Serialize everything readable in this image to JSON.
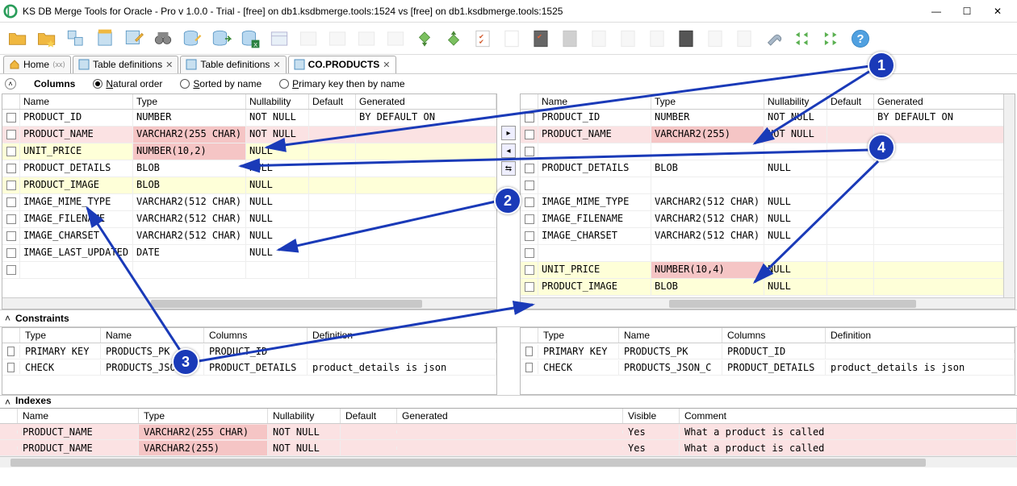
{
  "title": "KS DB Merge Tools for Oracle - Pro v 1.0.0 - Trial - [free] on db1.ksdbmerge.tools:1524 vs [free] on db1.ksdbmerge.tools:1525",
  "tabs": [
    {
      "label": "Home",
      "icon": "home"
    },
    {
      "label": "Table definitions",
      "icon": "grid"
    },
    {
      "label": "Table definitions",
      "icon": "grid"
    },
    {
      "label": "CO.PRODUCTS",
      "icon": "grid",
      "active": true
    }
  ],
  "filter": {
    "section": "Columns",
    "opt_natural": "Natural order",
    "opt_sorted": "Sorted by name",
    "opt_pk": "Primary key then by name"
  },
  "grid_headers": [
    "Name",
    "Type",
    "Nullability",
    "Default",
    "Generated"
  ],
  "left_rows": [
    {
      "name": "PRODUCT_ID",
      "type": "NUMBER",
      "null": "NOT NULL",
      "def": "",
      "gen": "BY DEFAULT ON",
      "cls": ""
    },
    {
      "name": "PRODUCT_NAME",
      "type": "VARCHAR2(255 CHAR)",
      "null": "NOT NULL",
      "def": "",
      "gen": "",
      "cls": "pink-full",
      "type_cls": "pink-cell"
    },
    {
      "name": "UNIT_PRICE",
      "type": "NUMBER(10,2)",
      "null": "NULL",
      "def": "",
      "gen": "",
      "cls": "yellow",
      "type_cls": "pink-cell"
    },
    {
      "name": "PRODUCT_DETAILS",
      "type": "BLOB",
      "null": "NULL",
      "def": "",
      "gen": "",
      "cls": ""
    },
    {
      "name": "PRODUCT_IMAGE",
      "type": "BLOB",
      "null": "NULL",
      "def": "",
      "gen": "",
      "cls": "yellow"
    },
    {
      "name": "IMAGE_MIME_TYPE",
      "type": "VARCHAR2(512 CHAR)",
      "null": "NULL",
      "def": "",
      "gen": "",
      "cls": ""
    },
    {
      "name": "IMAGE_FILENAME",
      "type": "VARCHAR2(512 CHAR)",
      "null": "NULL",
      "def": "",
      "gen": "",
      "cls": ""
    },
    {
      "name": "IMAGE_CHARSET",
      "type": "VARCHAR2(512 CHAR)",
      "null": "NULL",
      "def": "",
      "gen": "",
      "cls": ""
    },
    {
      "name": "IMAGE_LAST_UPDATED",
      "type": "DATE",
      "null": "NULL",
      "def": "",
      "gen": "",
      "cls": ""
    },
    {
      "name": "",
      "type": "",
      "null": "",
      "def": "",
      "gen": "",
      "cls": ""
    }
  ],
  "right_rows": [
    {
      "name": "PRODUCT_ID",
      "type": "NUMBER",
      "null": "NOT NULL",
      "def": "",
      "gen": "BY DEFAULT ON",
      "cls": ""
    },
    {
      "name": "PRODUCT_NAME",
      "type": "VARCHAR2(255)",
      "null": "NOT NULL",
      "def": "",
      "gen": "",
      "cls": "pink-full",
      "type_cls": "pink-cell"
    },
    {
      "name": "",
      "type": "",
      "null": "",
      "def": "",
      "gen": "",
      "cls": ""
    },
    {
      "name": "PRODUCT_DETAILS",
      "type": "BLOB",
      "null": "NULL",
      "def": "",
      "gen": "",
      "cls": ""
    },
    {
      "name": "",
      "type": "",
      "null": "",
      "def": "",
      "gen": "",
      "cls": ""
    },
    {
      "name": "IMAGE_MIME_TYPE",
      "type": "VARCHAR2(512 CHAR)",
      "null": "NULL",
      "def": "",
      "gen": "",
      "cls": ""
    },
    {
      "name": "IMAGE_FILENAME",
      "type": "VARCHAR2(512 CHAR)",
      "null": "NULL",
      "def": "",
      "gen": "",
      "cls": ""
    },
    {
      "name": "IMAGE_CHARSET",
      "type": "VARCHAR2(512 CHAR)",
      "null": "NULL",
      "def": "",
      "gen": "",
      "cls": ""
    },
    {
      "name": "",
      "type": "",
      "null": "",
      "def": "",
      "gen": "",
      "cls": ""
    },
    {
      "name": "UNIT_PRICE",
      "type": "NUMBER(10,4)",
      "null": "NULL",
      "def": "",
      "gen": "",
      "cls": "yellow",
      "type_cls": "pink-cell"
    },
    {
      "name": "PRODUCT_IMAGE",
      "type": "BLOB",
      "null": "NULL",
      "def": "",
      "gen": "",
      "cls": "yellow"
    }
  ],
  "constraints_label": "Constraints",
  "constraint_headers": [
    "Type",
    "Name",
    "Columns",
    "Definition"
  ],
  "left_constraints": [
    {
      "type": "PRIMARY KEY",
      "name": "PRODUCTS_PK",
      "cols": "PRODUCT_ID",
      "def": ""
    },
    {
      "type": "CHECK",
      "name": "PRODUCTS_JSON_C",
      "cols": "PRODUCT_DETAILS",
      "def": "product_details is json"
    }
  ],
  "right_constraints": [
    {
      "type": "PRIMARY KEY",
      "name": "PRODUCTS_PK",
      "cols": "PRODUCT_ID",
      "def": ""
    },
    {
      "type": "CHECK",
      "name": "PRODUCTS_JSON_C",
      "cols": "PRODUCT_DETAILS",
      "def": "product_details is json"
    }
  ],
  "indexes_label": "Indexes",
  "bottom_headers": [
    "Name",
    "Type",
    "Nullability",
    "Default",
    "Generated",
    "Visible",
    "Comment"
  ],
  "bottom_rows": [
    {
      "name": "PRODUCT_NAME",
      "type": "VARCHAR2(255 CHAR)",
      "null": "NOT NULL",
      "def": "",
      "gen": "",
      "vis": "Yes",
      "comment": "What a product is called",
      "type_cls": "pink-cell"
    },
    {
      "name": "PRODUCT_NAME",
      "type": "VARCHAR2(255)",
      "null": "NOT NULL",
      "def": "",
      "gen": "",
      "vis": "Yes",
      "comment": "What a product is called",
      "type_cls": "pink-cell"
    }
  ],
  "callouts": {
    "1": "1",
    "2": "2",
    "3": "3",
    "4": "4"
  }
}
